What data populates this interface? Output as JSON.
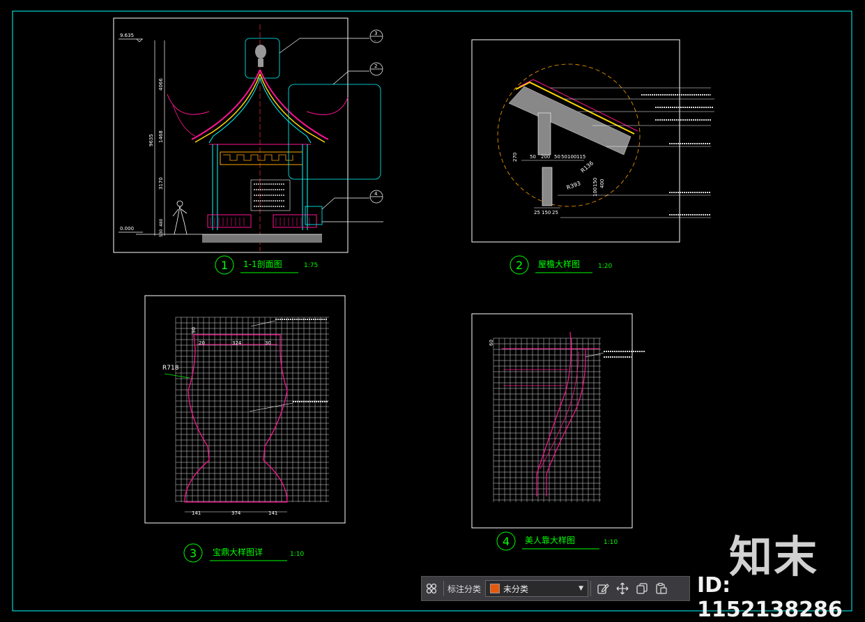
{
  "drawings": [
    {
      "number": "1",
      "title": "1-1剖面图",
      "scale": "1:75"
    },
    {
      "number": "2",
      "title": "屋檐大样图",
      "scale": "1:20"
    },
    {
      "number": "3",
      "title": "宝鼎大样图详",
      "scale": "1:10"
    },
    {
      "number": "4",
      "title": "美人靠大样图",
      "scale": "1:10"
    }
  ],
  "section_dims": {
    "top_level": "9.635",
    "base_level": "0.000",
    "total_height": "9635",
    "upper": "4066",
    "middle": "1468",
    "lower": "3170",
    "base_a": "480",
    "base_b": "530"
  },
  "eave_dims": {
    "d1": "50",
    "d2": "200",
    "d3": "50",
    "d4": "50",
    "d5": "100",
    "d6": "115",
    "h1": "270",
    "h2": "400",
    "h3": "100",
    "h4": "150",
    "b1": "25",
    "b2": "150",
    "b3": "25",
    "r1": "R136",
    "r2": "R393"
  },
  "finial_dims": {
    "top": "90",
    "w1": "20",
    "w2": "324",
    "w3": "30",
    "radius": "R718",
    "b1": "141",
    "b2": "374",
    "b3": "141"
  },
  "bench_dims": {
    "top": "60"
  },
  "colors": {
    "bg": "#000000",
    "frame": "#ffffff",
    "green": "#00ff00",
    "magenta": "#ff1493",
    "cyan": "#00ffff",
    "yellow": "#ffd700"
  },
  "toolbar": {
    "grid_icon": "grid-icon",
    "label": "标注分类",
    "select_value": "未分类",
    "swatch_color": "#e8590c",
    "edit_icon": "edit-icon",
    "move_icon": "move-icon",
    "copy_icon": "copy-icon",
    "paste_icon": "paste-icon"
  },
  "watermark": {
    "logo": "知末",
    "id": "ID: 1152138286"
  }
}
